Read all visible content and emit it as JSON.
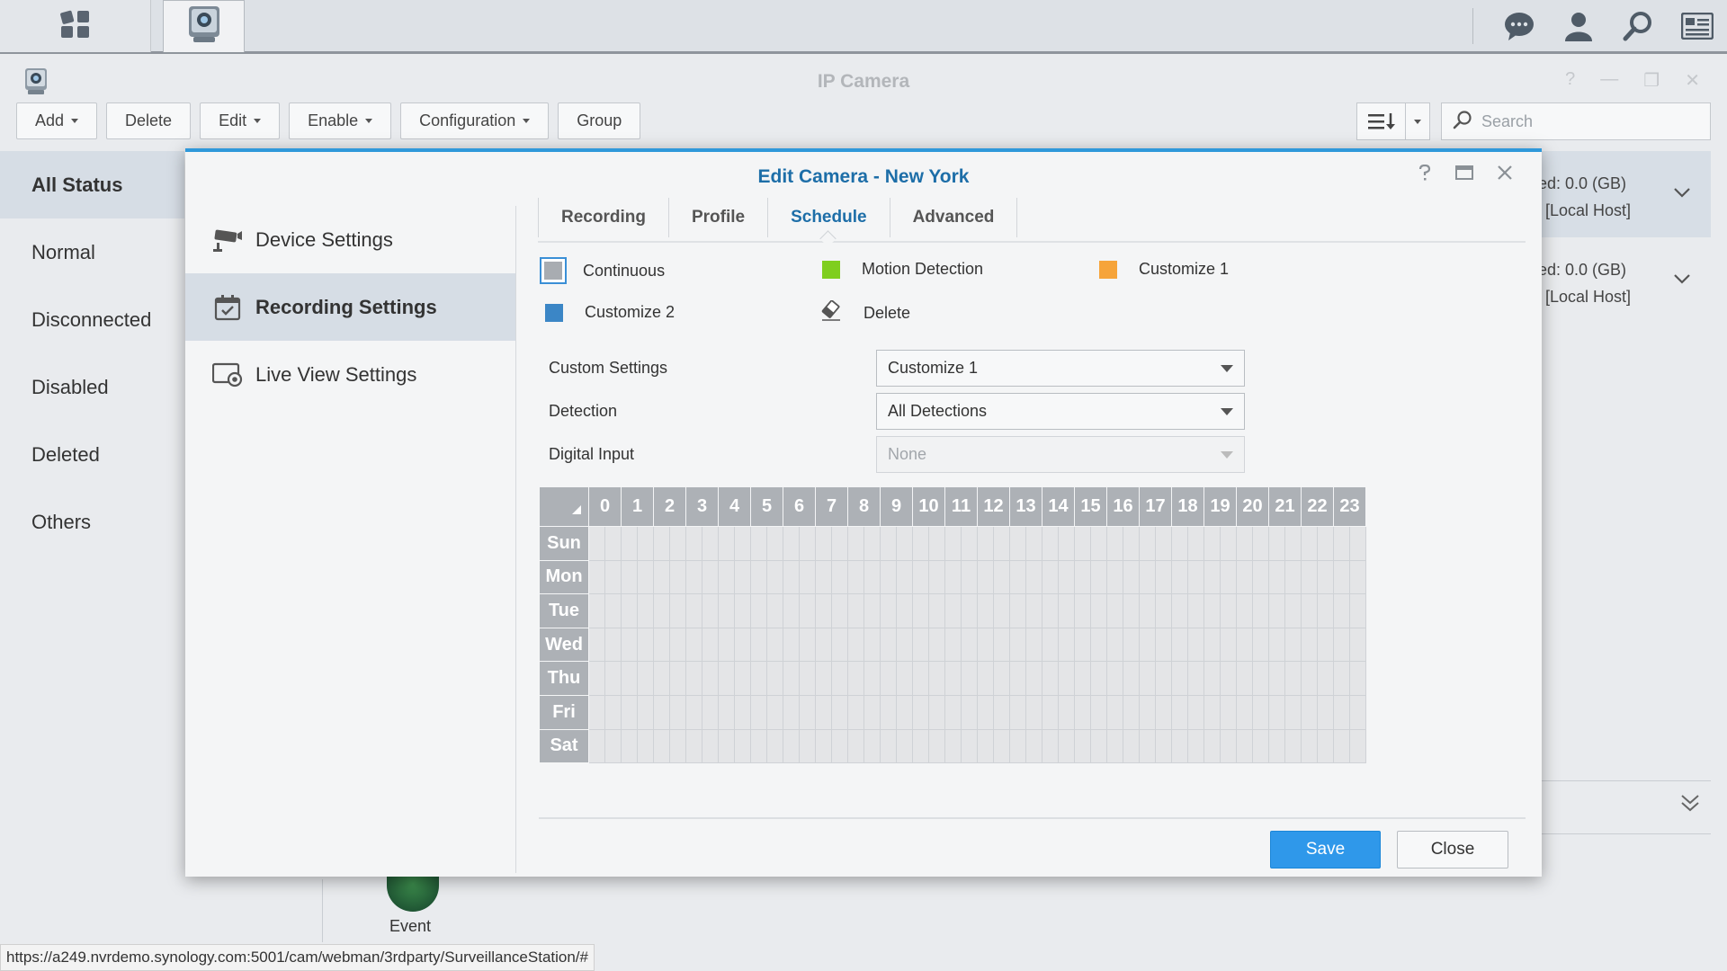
{
  "taskbar": {
    "buttons": [
      {
        "name": "main-menu",
        "icon": "grid-icon"
      },
      {
        "name": "surveillance-app",
        "icon": "camera-app-icon"
      }
    ],
    "right_icons": [
      "chat-icon",
      "user-icon",
      "search-icon",
      "widgets-icon"
    ]
  },
  "app": {
    "title": "IP Camera",
    "toolbar": {
      "add": "Add",
      "delete": "Delete",
      "edit": "Edit",
      "enable": "Enable",
      "configuration": "Configuration",
      "group": "Group"
    },
    "search_placeholder": "Search",
    "status_nav": [
      "All Status",
      "Normal",
      "Disconnected",
      "Disabled",
      "Deleted",
      "Others"
    ],
    "bg_rows": [
      {
        "line1": "ed: 0.0 (GB)",
        "line2": "[Local Host]"
      },
      {
        "line1": "ed: 0.0 (GB)",
        "line2": "[Local Host]"
      }
    ],
    "event_label": "Event",
    "status_url": "https://a249.nvrdemo.synology.com:5001/cam/webman/3rdparty/SurveillanceStation/#"
  },
  "modal": {
    "title": "Edit Camera - New York",
    "side": [
      "Device Settings",
      "Recording Settings",
      "Live View Settings"
    ],
    "tabs": [
      "Recording",
      "Profile",
      "Schedule",
      "Advanced"
    ],
    "active_tab": "Schedule",
    "legend": {
      "continuous": "Continuous",
      "motion": "Motion Detection",
      "customize1": "Customize 1",
      "customize2": "Customize 2",
      "delete": "Delete"
    },
    "colors": {
      "continuous": "#a8acb1",
      "motion": "#7fce1e",
      "customize1": "#f6a43a",
      "customize2": "#3b86c6",
      "accent": "#2f98ea"
    },
    "form": {
      "custom_settings_label": "Custom Settings",
      "custom_settings_value": "Customize 1",
      "detection_label": "Detection",
      "detection_value": "All Detections",
      "digital_input_label": "Digital Input",
      "digital_input_value": "None"
    },
    "schedule": {
      "hours": [
        "0",
        "1",
        "2",
        "3",
        "4",
        "5",
        "6",
        "7",
        "8",
        "9",
        "10",
        "11",
        "12",
        "13",
        "14",
        "15",
        "16",
        "17",
        "18",
        "19",
        "20",
        "21",
        "22",
        "23"
      ],
      "days": [
        "Sun",
        "Mon",
        "Tue",
        "Wed",
        "Thu",
        "Fri",
        "Sat"
      ]
    },
    "save": "Save",
    "close": "Close"
  }
}
